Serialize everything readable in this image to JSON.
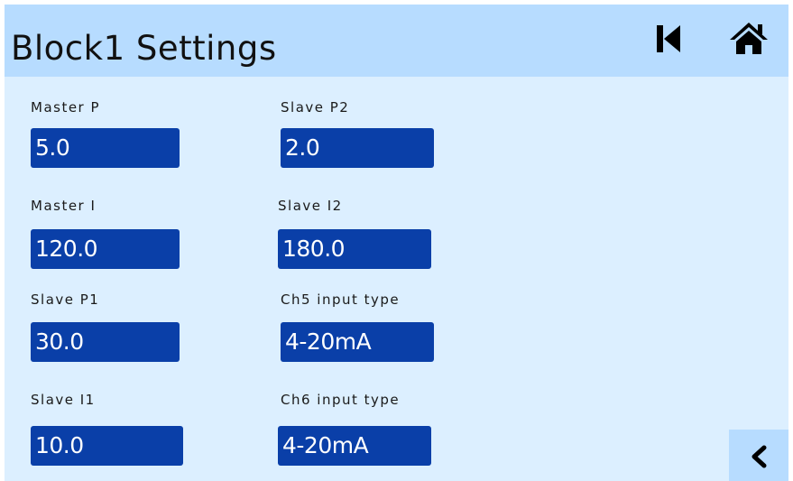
{
  "header": {
    "title": "Block1 Settings",
    "prev_icon": "skip-previous-icon",
    "home_icon": "home-icon"
  },
  "fields": {
    "master_p": {
      "label": "Master P",
      "value": "5.0"
    },
    "master_i": {
      "label": "Master I",
      "value": "120.0"
    },
    "slave_p1": {
      "label": "Slave P1",
      "value": "30.0"
    },
    "slave_i1": {
      "label": "Slave I1",
      "value": "10.0"
    },
    "slave_p2": {
      "label": "Slave P2",
      "value": "2.0"
    },
    "slave_i2": {
      "label": "Slave I2",
      "value": "180.0"
    },
    "ch5_input_type": {
      "label": "Ch5 input type",
      "value": "4-20mA"
    },
    "ch6_input_type": {
      "label": "Ch6 input type",
      "value": "4-20mA"
    }
  },
  "footer": {
    "back_icon": "chevron-left-icon"
  },
  "colors": {
    "background": "#dcefff",
    "header": "#b7dcff",
    "field": "#0a3fa8",
    "field_text": "#ffffff"
  }
}
